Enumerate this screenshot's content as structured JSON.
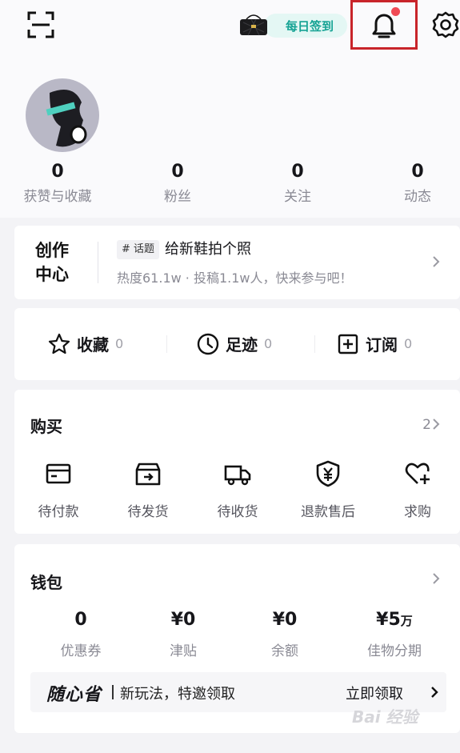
{
  "header": {
    "checkin_label": "每日签到",
    "icons": [
      "scan-icon",
      "handbag-icon",
      "bell-icon",
      "gear-icon"
    ],
    "notification_dot_color": "#f04a55",
    "highlight_color": "#c8242a"
  },
  "profile": {
    "stats": [
      {
        "value": "0",
        "label": "获赞与收藏"
      },
      {
        "value": "0",
        "label": "粉丝"
      },
      {
        "value": "0",
        "label": "关注"
      },
      {
        "value": "0",
        "label": "动态"
      }
    ]
  },
  "creator": {
    "title_line1": "创作",
    "title_line2": "中心",
    "tag": "# 话题",
    "topic": "给新鞋拍个照",
    "subtitle": "热度61.1w · 投稿1.1w人，快来参与吧！"
  },
  "quick_links": [
    {
      "label": "收藏",
      "count": "0",
      "icon": "star-icon"
    },
    {
      "label": "足迹",
      "count": "0",
      "icon": "clock-icon"
    },
    {
      "label": "订阅",
      "count": "0",
      "icon": "plus-square-icon"
    }
  ],
  "buy": {
    "title": "购买",
    "count": "2",
    "items": [
      {
        "label": "待付款",
        "icon": "card-icon"
      },
      {
        "label": "待发货",
        "icon": "box-icon"
      },
      {
        "label": "待收货",
        "icon": "truck-icon"
      },
      {
        "label": "退款售后",
        "icon": "shield-yen-icon"
      },
      {
        "label": "求购",
        "icon": "heart-plus-icon"
      }
    ]
  },
  "wallet": {
    "title": "钱包",
    "items": [
      {
        "value": "0",
        "unit": "",
        "label": "优惠券"
      },
      {
        "value": "¥0",
        "unit": "",
        "label": "津贴"
      },
      {
        "value": "¥0",
        "unit": "",
        "label": "余额"
      },
      {
        "value": "¥5",
        "unit": "万",
        "label": "佳物分期"
      }
    ],
    "promo_logo": "随心省",
    "promo_text": "新玩法，特邀领取",
    "promo_cta": "立即领取"
  },
  "watermark": "Bai 经验"
}
